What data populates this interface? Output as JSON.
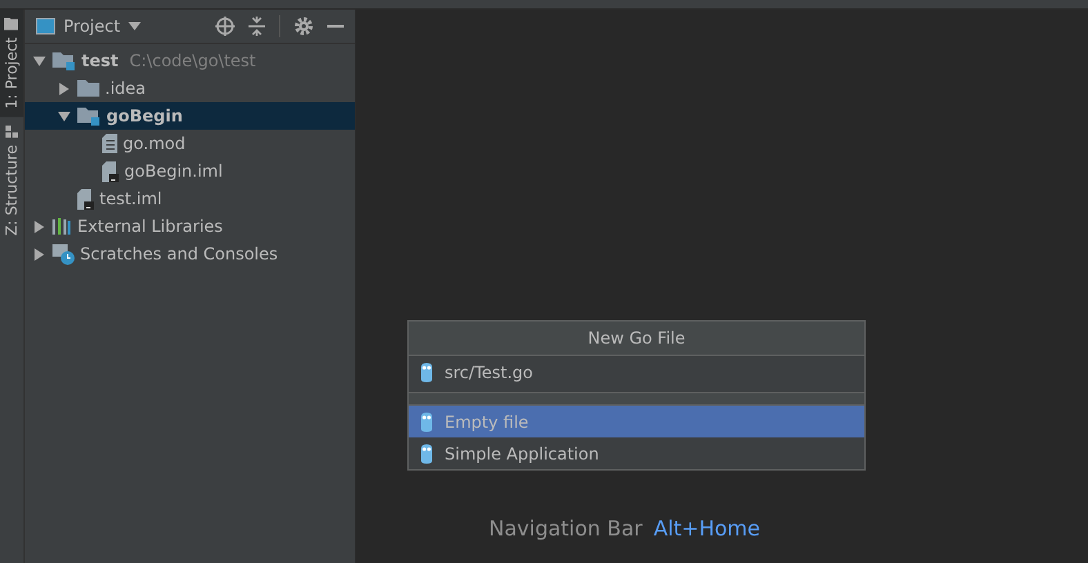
{
  "tool_strip": [
    {
      "label": "1: Project",
      "selected": true,
      "kind": "folder"
    },
    {
      "label": "Z: Structure",
      "selected": false,
      "kind": "structure"
    }
  ],
  "project_panel": {
    "title": "Project",
    "tree": [
      {
        "label": "test",
        "detail": "C:\\code\\go\\test",
        "kind": "module",
        "expanded": true,
        "selected": false,
        "children": [
          {
            "label": ".idea",
            "kind": "folder",
            "expanded": false,
            "selected": false
          },
          {
            "label": "goBegin",
            "kind": "module",
            "expanded": true,
            "selected": true,
            "children": [
              {
                "label": "go.mod",
                "kind": "file",
                "selected": false
              },
              {
                "label": "goBegin.iml",
                "kind": "iml",
                "selected": false
              }
            ]
          },
          {
            "label": "test.iml",
            "kind": "iml",
            "selected": false
          }
        ]
      },
      {
        "label": "External Libraries",
        "kind": "libraries",
        "expanded": false,
        "selected": false
      },
      {
        "label": "Scratches and Consoles",
        "kind": "scratches",
        "expanded": false,
        "selected": false
      }
    ]
  },
  "editor_hints": [
    {
      "label": "Navigation Bar",
      "shortcut": "Alt+Home"
    }
  ],
  "popup": {
    "title": "New Go File",
    "items": [
      {
        "label": "src/Test.go",
        "kind": "item",
        "selected": false
      },
      {
        "kind": "separator"
      },
      {
        "label": "Empty file",
        "kind": "item",
        "selected": true
      },
      {
        "label": "Simple Application",
        "kind": "item",
        "selected": false
      }
    ]
  }
}
